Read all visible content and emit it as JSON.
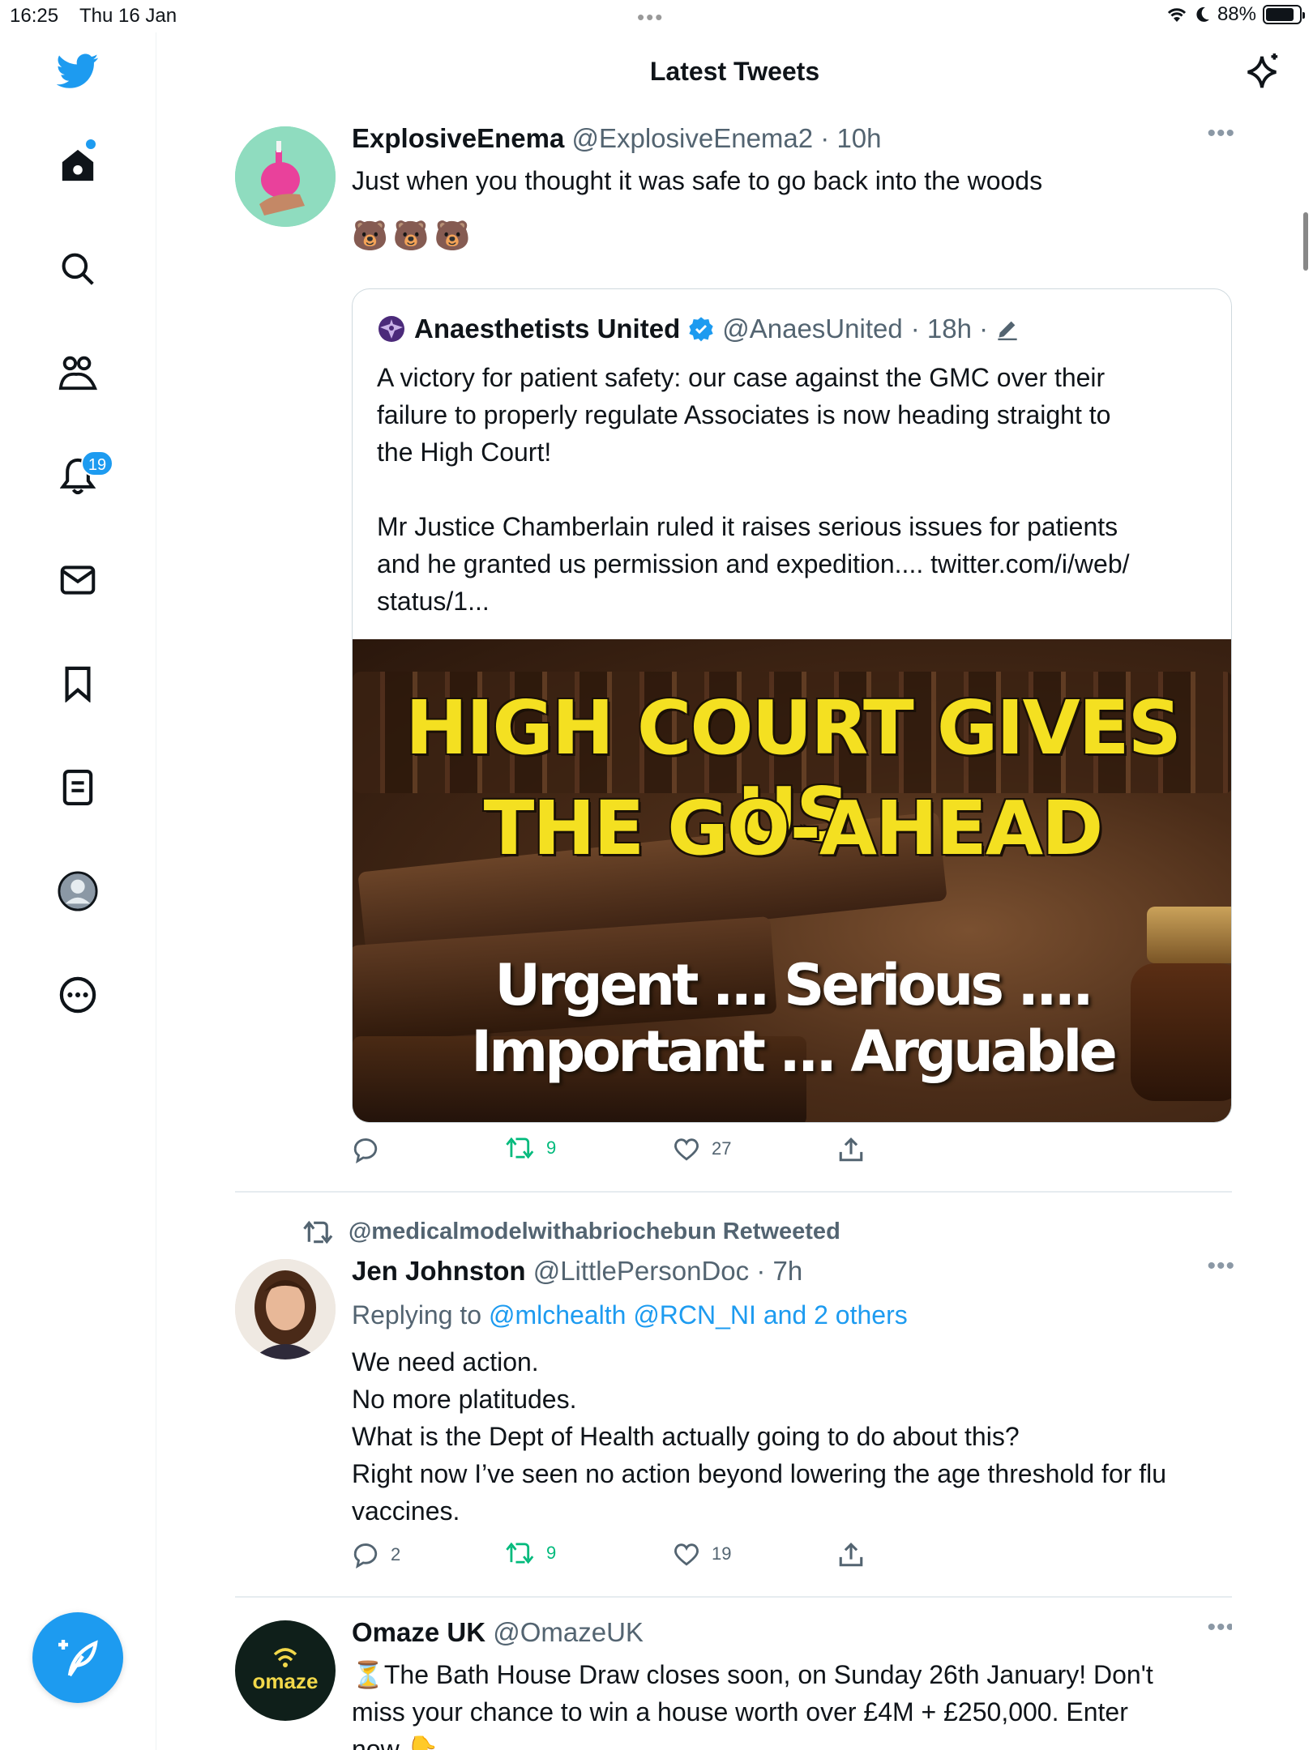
{
  "status_bar": {
    "time": "16:25",
    "date": "Thu 16 Jan",
    "battery": "88%"
  },
  "header": {
    "title": "Latest Tweets"
  },
  "nav": {
    "items": [
      "home",
      "search",
      "communities",
      "notifications",
      "messages",
      "bookmarks",
      "lists",
      "profile",
      "more"
    ],
    "notification_count": "19"
  },
  "tweets": [
    {
      "name": "ExplosiveEnema",
      "handle": "@ExplosiveEnema2",
      "time": "· 10h",
      "text": "Just when you thought it was safe to go back into the woods",
      "emoji": "🐻🐻🐻",
      "quote": {
        "name": "Anaesthetists United",
        "handle": "@AnaesUnited",
        "time": "· 18h ·",
        "text_p1_l1": "A victory for patient safety: our case against the GMC over their",
        "text_p1_l2": "failure to properly regulate Associates is now heading straight to",
        "text_p1_l3": "the High Court!",
        "text_p2_l1": "Mr Justice Chamberlain ruled it raises serious issues for patients",
        "text_p2_l2": "and he granted us permission and expedition.... twitter.com/i/web/",
        "text_p2_l3": "status/1...",
        "image_headline_1": "HIGH COURT GIVES US",
        "image_headline_2": "THE GO-AHEAD",
        "image_sub_1": "Urgent ... Serious ....",
        "image_sub_2": "Important ... Arguable"
      },
      "replies": "",
      "retweets": "9",
      "likes": "27"
    },
    {
      "retweeted_by": "@medicalmodelwithabriochebun Retweeted",
      "name": "Jen Johnston",
      "handle": "@LittlePersonDoc",
      "time": "· 7h",
      "replying_prefix": "Replying to",
      "replying_to": "@mlchealth @RCN_NI and 2 others",
      "lines": [
        "We need action.",
        "No more platitudes.",
        "What is the Dept of Health actually going to do about this?",
        "Right now I’ve seen no action beyond lowering the age threshold for flu",
        "vaccines."
      ],
      "replies": "2",
      "retweets": "9",
      "likes": "19"
    },
    {
      "name": "Omaze UK",
      "handle": "@OmazeUK",
      "avatar_text": "omaze",
      "line_1": "⏳The Bath House Draw closes soon, on Sunday 26th January! Don't",
      "line_2": "miss your chance to win a house worth over £4M + £250,000. Enter",
      "line_3": "now 👇"
    }
  ],
  "colors": {
    "accent": "#1d9bf0",
    "retweet": "#00ba7c",
    "muted": "#536471",
    "headline_yellow": "#f4e021"
  },
  "icons": [
    "twitter-logo-icon",
    "home-icon",
    "search-icon",
    "communities-icon",
    "bell-icon",
    "mail-icon",
    "bookmark-icon",
    "list-icon",
    "avatar-icon",
    "more-icon",
    "compose-icon",
    "sparkle-icon",
    "reply-icon",
    "retweet-icon",
    "like-icon",
    "share-icon",
    "verified-icon",
    "edit-icon"
  ]
}
